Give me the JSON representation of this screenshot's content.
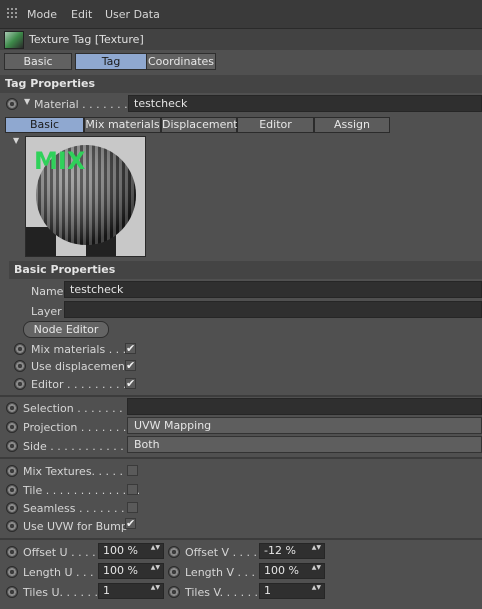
{
  "menubar": {
    "items": [
      "Mode",
      "Edit",
      "User Data"
    ]
  },
  "tag": {
    "title": "Texture Tag [Texture]"
  },
  "tabs": [
    "Basic",
    "Tag",
    "Coordinates"
  ],
  "active_tab": "Tag",
  "tag_properties": {
    "header": "Tag Properties",
    "material_label": "Material . . . . . . .",
    "material_value": "testcheck",
    "subtabs": [
      "Basic",
      "Mix materials",
      "Displacement",
      "Editor",
      "Assign"
    ],
    "preview_text": "MIX",
    "basic_header": "Basic Properties",
    "name_label": "Name",
    "name_value": "testcheck",
    "layer_label": "Layer",
    "layer_value": "",
    "node_editor": "Node Editor",
    "mix_label": "Mix materials . . . .",
    "mix_checked": "✔",
    "displacement_label": "Use displacement",
    "displacement_checked": "✔",
    "editor_label": "Editor . . . . . . . . . .",
    "editor_checked": "✔"
  },
  "projection": {
    "selection_label": "Selection . . . . . . . .",
    "selection_value": "",
    "projection_label": "Projection . . . . . . .",
    "projection_value": "UVW Mapping",
    "side_label": "Side . . . . . . . . . . . .",
    "side_value": "Both"
  },
  "options": {
    "mix_textures_label": "Mix Textures. . . . . .",
    "tile_label": "Tile . . . . . . . . . . . . . .",
    "seamless_label": "Seamless . . . . . . . .",
    "uvw_bump_label": "Use UVW for Bump",
    "uvw_bump_checked": "✔"
  },
  "offsets": {
    "offset_u_label": "Offset U . . . .",
    "offset_u_value": "100 %",
    "offset_v_label": "Offset V . . . .",
    "offset_v_value": "-12 %",
    "length_u_label": "Length U . . . .",
    "length_u_value": "100 %",
    "length_v_label": "Length V . . . .",
    "length_v_value": "100 %",
    "tiles_u_label": "Tiles U. . . . . .",
    "tiles_u_value": "1",
    "tiles_v_label": "Tiles V. . . . . .",
    "tiles_v_value": "1",
    "spin_arrows": "▲▼"
  }
}
